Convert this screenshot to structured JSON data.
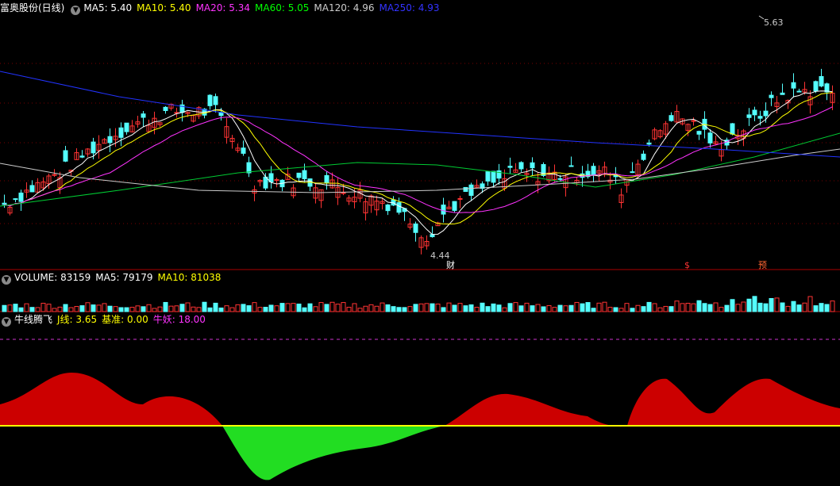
{
  "main_header": {
    "title": "富奥股份(日线)",
    "items": [
      {
        "label": "MA5: 5.40",
        "color": "#ffffff"
      },
      {
        "label": "MA10: 5.40",
        "color": "#ffff00"
      },
      {
        "label": "MA20: 5.34",
        "color": "#ff33ff"
      },
      {
        "label": "MA60: 5.05",
        "color": "#00ff00"
      },
      {
        "label": "MA120: 4.96",
        "color": "#cccccc"
      },
      {
        "label": "MA250: 4.93",
        "color": "#3333ff"
      }
    ]
  },
  "volume_header": {
    "items": [
      {
        "label": "VOLUME: 83159",
        "color": "#ffffff"
      },
      {
        "label": "MA5: 79179",
        "color": "#ffffff"
      },
      {
        "label": "MA10: 81038",
        "color": "#ffff00"
      }
    ]
  },
  "ind_header": {
    "items": [
      {
        "label": "牛线腾飞",
        "color": "#ffffff"
      },
      {
        "label": "J线: 3.65",
        "color": "#ffff00"
      },
      {
        "label": "基准: 0.00",
        "color": "#ffff00"
      },
      {
        "label": "牛妖: 18.00",
        "color": "#ff33ff"
      }
    ]
  },
  "chart_data": {
    "type": "candlestick",
    "high_label": "5.63",
    "low_label": "4.44",
    "markers": [
      {
        "text": "财",
        "color": "#ffffff"
      },
      {
        "text": "$",
        "color": "#ff3333"
      },
      {
        "text": "预",
        "color": "#ff6633"
      }
    ],
    "colors": {
      "up": "#ff3333",
      "down": "#54ffff",
      "ma5": "#ffffff",
      "ma10": "#ffff00",
      "ma20": "#ff33ff",
      "ma60": "#00cc33",
      "ma120": "#cccccc",
      "ma250": "#2233ff"
    }
  }
}
